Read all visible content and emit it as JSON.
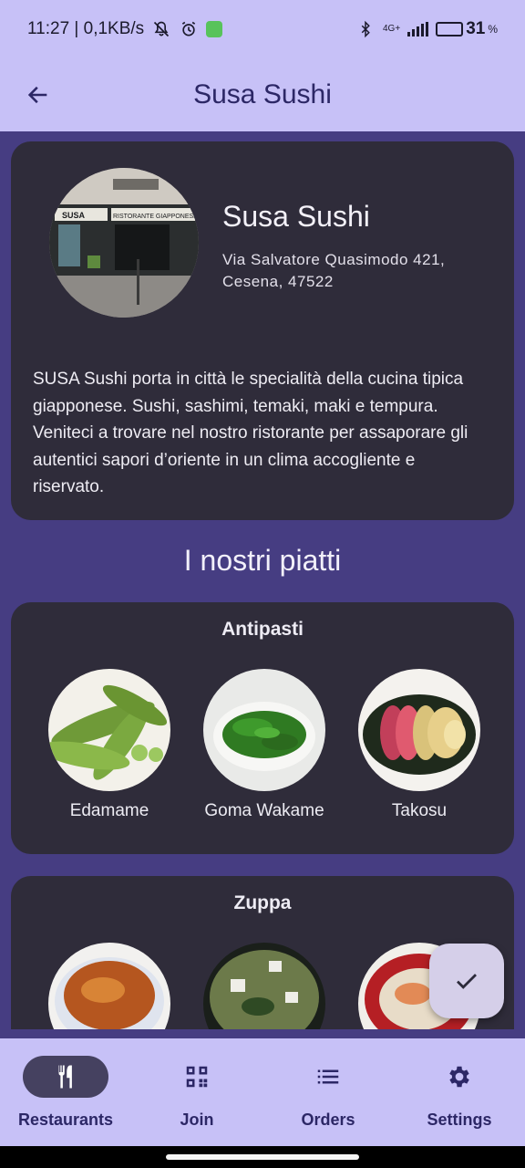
{
  "status_bar": {
    "time": "11:27 | 0,1KB/s",
    "network_type": "4G+",
    "battery": "31",
    "battery_unit": "%",
    "battery_level": 0.31,
    "icons": [
      "mute-icon",
      "alarm-icon",
      "app-notification-icon",
      "bluetooth-icon",
      "signal-icon",
      "battery-icon"
    ]
  },
  "app_bar": {
    "title": "Susa Sushi",
    "back_icon": "arrow-back-icon"
  },
  "restaurant": {
    "name": "Susa Sushi",
    "address": "Via Salvatore Quasimodo 421, Cesena, 47522",
    "description": "SUSA Sushi porta in città le specialità della cucina tipica giapponese. Sushi, sashimi, temaki, maki e tempura. Veniteci a trovare nel nostro ristorante per assaporare gli autentici sapori d’oriente in un clima accogliente e riservato.",
    "photo_sign_left": "SUSA",
    "photo_sign_right": "RISTORANTE GIAPPONESE"
  },
  "dishes_section": {
    "title": "I nostri piatti",
    "categories": [
      {
        "name": "Antipasti",
        "dishes": [
          {
            "name": "Edamame"
          },
          {
            "name": "Goma Wakame"
          },
          {
            "name": "Takosu"
          }
        ]
      },
      {
        "name": "Zuppa",
        "dishes": [
          {
            "name": ""
          },
          {
            "name": ""
          },
          {
            "name": ""
          }
        ]
      }
    ]
  },
  "fab": {
    "icon": "check-icon"
  },
  "bottom_nav": {
    "items": [
      {
        "label": "Restaurants",
        "icon": "restaurant-icon",
        "active": true
      },
      {
        "label": "Join",
        "icon": "qr-code-icon",
        "active": false
      },
      {
        "label": "Orders",
        "icon": "list-icon",
        "active": false
      },
      {
        "label": "Settings",
        "icon": "gear-icon",
        "active": false
      }
    ]
  },
  "colors": {
    "app_bar": "#c7c1f7",
    "background": "#463d82",
    "card": "#2f2c3a",
    "title_text": "#2c2766",
    "nav_active_indicator": "#454160",
    "fab": "#d5cfe9"
  }
}
